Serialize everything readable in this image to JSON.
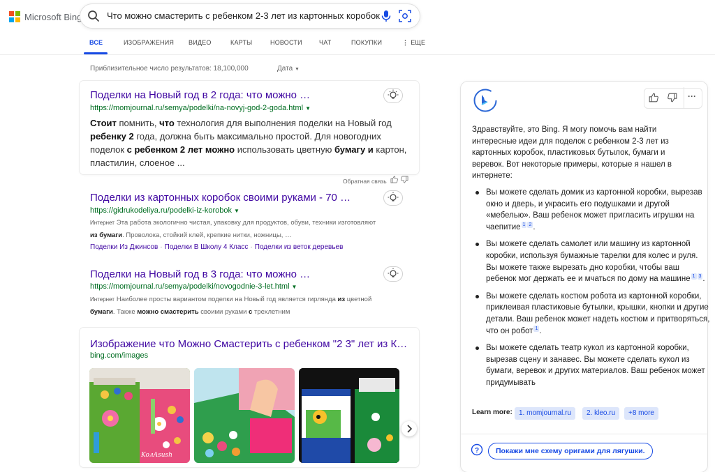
{
  "brand": {
    "name": "Microsoft Bing",
    "colors": [
      "#f25022",
      "#7fba00",
      "#00a4ef",
      "#ffb900"
    ]
  },
  "search": {
    "query": "Что можно смастерить с ребенком 2-3 лет из картонных коробок"
  },
  "tabs": [
    {
      "label": "ВСЕ",
      "active": true
    },
    {
      "label": "ИЗОБРАЖЕНИЯ"
    },
    {
      "label": "ВИДЕО"
    },
    {
      "label": "КАРТЫ"
    },
    {
      "label": "НОВОСТИ"
    },
    {
      "label": "ЧАТ"
    },
    {
      "label": "ПОКУПКИ"
    },
    {
      "label": "ЕЩЕ",
      "icon": "more-vertical-icon"
    }
  ],
  "results_info": {
    "count_text": "Приблизительное число результатов: 18,100,000",
    "date_filter": "Дата"
  },
  "results": [
    {
      "title": "Поделки на Новый год в 2 года: что можно …",
      "url": "https://momjournal.ru/semya/podelki/na-novyj-god-2-goda.html",
      "snippet": [
        {
          "b": "Стоит"
        },
        {
          "t": " помнить, "
        },
        {
          "b": "что"
        },
        {
          "t": " технология для выполнения поделки на Новый год "
        },
        {
          "b": "ребенку 2"
        },
        {
          "t": " года, должна быть максимально простой. Для новогодних поделок "
        },
        {
          "b": "с ребенком 2 лет можно"
        },
        {
          "t": " использовать цветную "
        },
        {
          "b": "бумагу и"
        },
        {
          "t": " картон, пластилин, слоеное ..."
        }
      ],
      "feedback_label": "Обратная связь"
    },
    {
      "title": "Поделки из картонных коробок своими руками - 70 …",
      "url": "https://gidrukodeliya.ru/podelki-iz-korobok",
      "tag": "Интернет",
      "snippet_line1": "Эта работа экологично чистая, упаковку для продуктов, обуви, техники изготовляют",
      "snippet_line2_b": "из бумаги",
      "snippet_line2": ". Проволока, стойкий клей, крепкие нитки, ножницы, …",
      "deeplinks": [
        "Поделки Из Джинсов",
        "Поделки В Школу 4 Класс",
        "Поделки из веток деревьев"
      ]
    },
    {
      "title": "Поделки на Новый год в 3 года: что можно …",
      "url": "https://momjournal.ru/semya/podelki/novogodnie-3-let.html",
      "tag": "Интернет",
      "snippet_line1a": "Наиболее просты вариантом поделки на Новый год является гирлянда ",
      "snippet_line1b": "из",
      "snippet_line1c": " цветной",
      "snippet_line2a": "бумаги",
      "snippet_line2b": ". Также ",
      "snippet_line2c": "можно смастерить",
      "snippet_line2d": " своими руками ",
      "snippet_line2e": "с",
      "snippet_line2f": " трехлетним"
    }
  ],
  "images": {
    "title": "Изображение что Можно Смастерить с ребенком \"2 3\" лет из К…",
    "source": "bing.com/images",
    "watermark": "KoлAsush"
  },
  "chat": {
    "greeting": "Здравствуйте, это Bing. Я могу помочь вам найти интересные идеи для поделок с ребенком 2-3 лет из картонных коробок, пластиковых бутылок, бумаги и веревок. Вот некоторые примеры, которые я нашел в интернете:",
    "bullets": [
      {
        "text": "Вы можете сделать домик из картонной коробки, вырезав окно и дверь, и украсить его подушками и другой «мебелью». Ваш ребенок может пригласить игрушки на чаепитие",
        "cites": [
          "1",
          "2"
        ],
        "end": "."
      },
      {
        "text": "Вы можете сделать самолет или машину из картонной коробки, используя бумажные тарелки для колес и руля. Вы можете также вырезать дно коробки, чтобы ваш ребенок мог держать ее и мчаться по дому на машине",
        "cites": [
          "1",
          "3"
        ],
        "end": "."
      },
      {
        "text": "Вы можете сделать костюм робота из картонной коробки, приклеивая пластиковые бутылки, крышки, кнопки и другие детали. Ваш ребенок может надеть костюм и притворяться, что он робот",
        "cites": [
          "1"
        ],
        "end": "."
      },
      {
        "text": "Вы можете сделать театр кукол из картонной коробки, вырезав сцену и занавес. Вы можете сделать кукол из бумаги, веревок и других материалов. Ваш ребенок может придумывать",
        "cites": [],
        "end": ""
      }
    ],
    "learn_more_label": "Learn more:",
    "learn_more": [
      "1. momjournal.ru",
      "2. kleo.ru",
      "+8 more"
    ],
    "suggestion": "Покажи мне схему оригами для лягушки."
  }
}
